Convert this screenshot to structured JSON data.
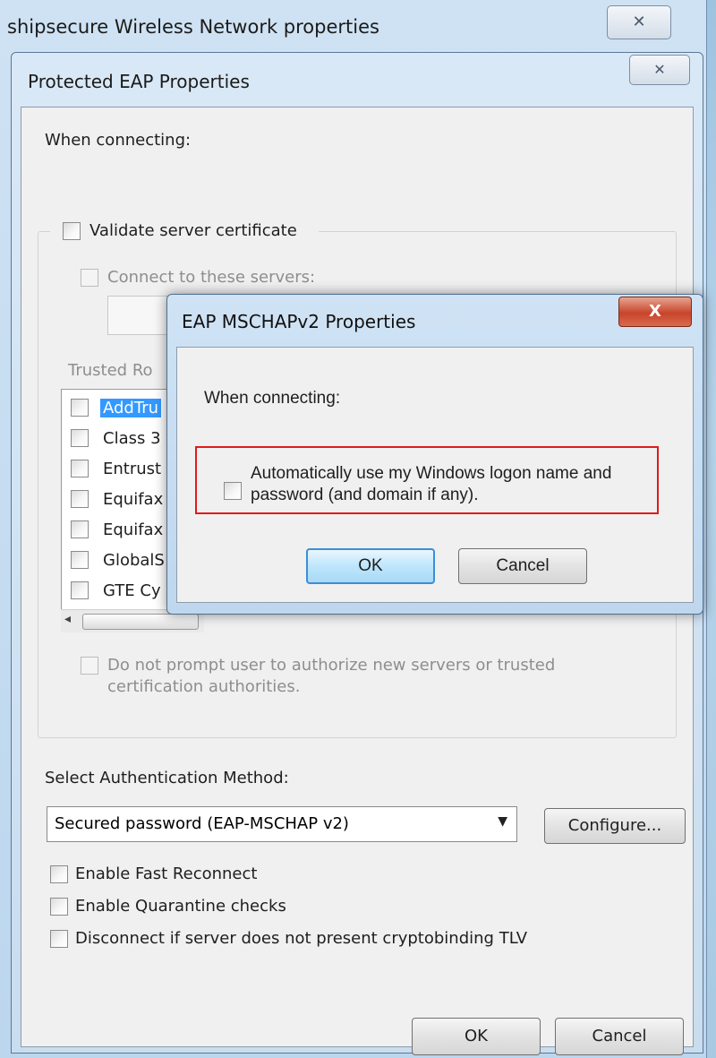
{
  "outer_window": {
    "title": "shipsecure Wireless Network properties",
    "close_glyph": "✕"
  },
  "peap": {
    "title": "Protected EAP Properties",
    "close_glyph": "✕",
    "when_connecting": "When connecting:",
    "validate_cert": {
      "label": "Validate server certificate",
      "checked": false
    },
    "connect_servers": {
      "label": "Connect to these servers:",
      "checked": false,
      "value": ""
    },
    "trusted_root_label": "Trusted Ro",
    "trusted_roots": [
      {
        "label": "AddTru",
        "selected": true
      },
      {
        "label": "Class 3",
        "selected": false
      },
      {
        "label": "Entrust",
        "selected": false
      },
      {
        "label": "Equifax",
        "selected": false
      },
      {
        "label": "Equifax",
        "selected": false
      },
      {
        "label": "GlobalS",
        "selected": false
      },
      {
        "label": "GTE Cy",
        "selected": false
      }
    ],
    "scroll_left_glyph": "◂",
    "do_not_prompt": {
      "line1": "Do not prompt user to authorize new servers or trusted",
      "line2": "certification authorities."
    },
    "auth_method_label": "Select Authentication Method:",
    "auth_method_value": "Secured password (EAP-MSCHAP v2)",
    "dropdown_glyph": "▼",
    "configure_label": "Configure...",
    "fast_reconnect": "Enable Fast Reconnect",
    "quarantine": "Enable Quarantine checks",
    "cryptobinding": "Disconnect if server does not present cryptobinding TLV",
    "ok_label": "OK",
    "cancel_label": "Cancel"
  },
  "mschap": {
    "title": "EAP MSCHAPv2 Properties",
    "close_glyph": "X",
    "when_connecting": "When connecting:",
    "auto_logon_line1": "Automatically use my Windows logon name and",
    "auto_logon_line2": "password (and domain if any).",
    "auto_logon_checked": false,
    "ok_label": "OK",
    "cancel_label": "Cancel"
  },
  "colors": {
    "highlight": "#e01b1b",
    "selection": "#3399ff",
    "close_red": "#c7452a"
  }
}
